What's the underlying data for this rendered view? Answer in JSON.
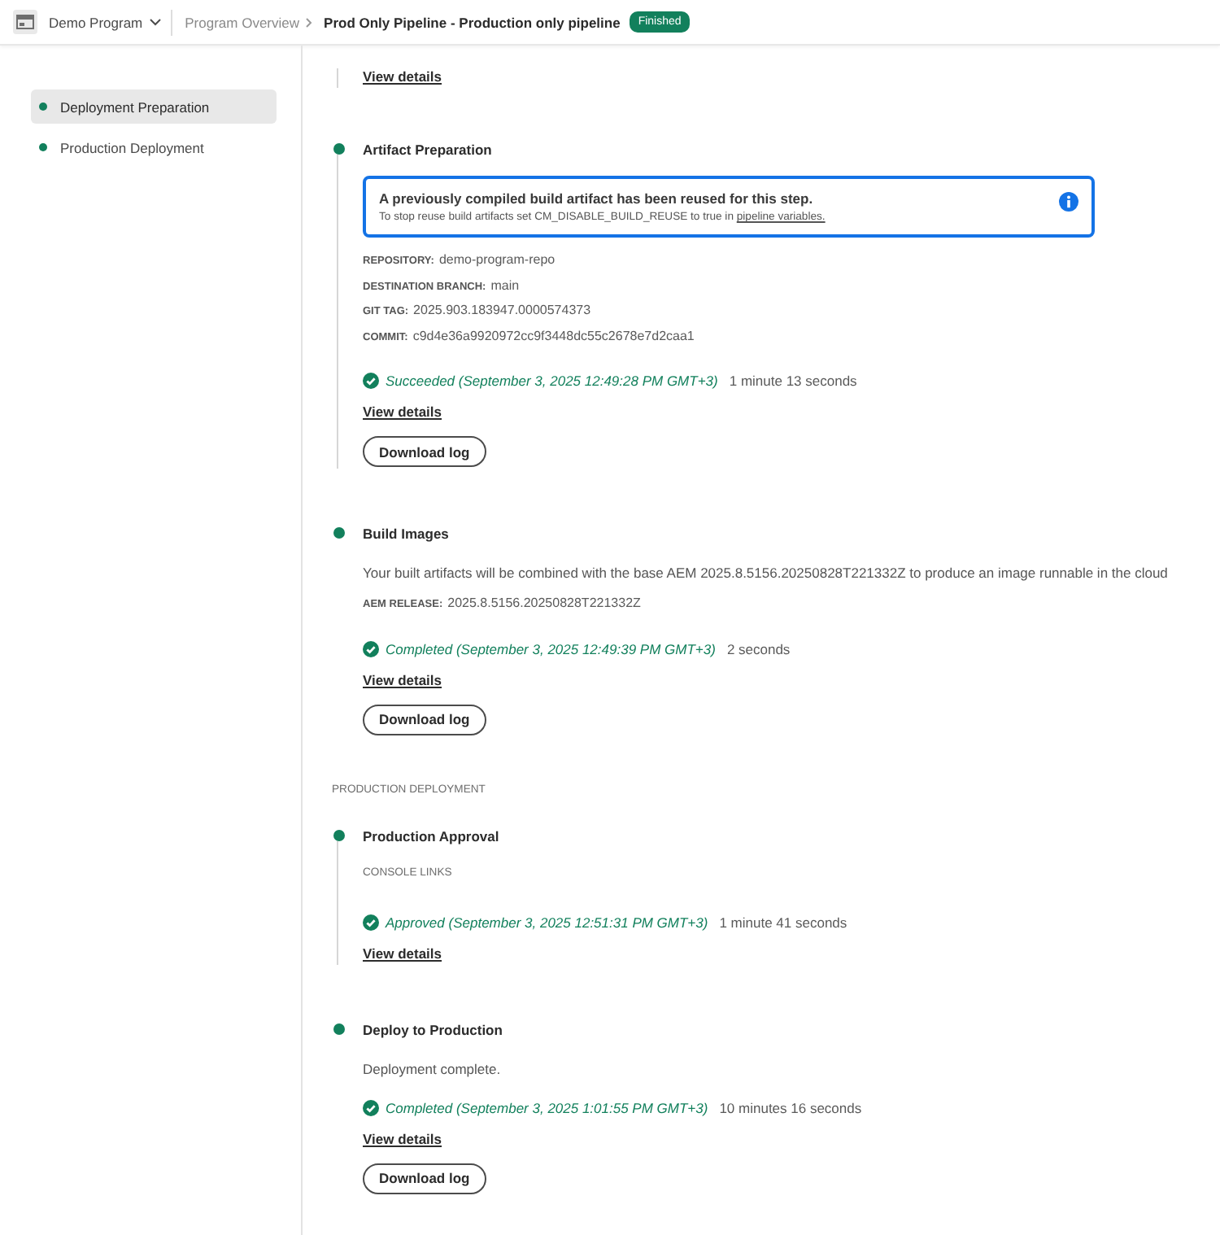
{
  "header": {
    "program": "Demo Program",
    "breadcrumb": "Program Overview",
    "title": "Prod Only Pipeline - Production only pipeline",
    "status_badge": "Finished"
  },
  "sidebar": {
    "items": [
      {
        "label": "Deployment Preparation",
        "selected": true
      },
      {
        "label": "Production Deployment",
        "selected": false
      }
    ]
  },
  "timeline": [
    {
      "kind": "tail",
      "view_details": "View details"
    },
    {
      "kind": "step",
      "title": "Artifact Preparation",
      "notice": {
        "title": "A previously compiled build artifact has been reused for this step.",
        "text": "To stop reuse build artifacts set CM_DISABLE_BUILD_REUSE to true in ",
        "link": "pipeline variables."
      },
      "fields": [
        {
          "label": "REPOSITORY:",
          "value": "demo-program-repo"
        },
        {
          "label": "DESTINATION BRANCH:",
          "value": "main"
        },
        {
          "label": "GIT TAG:",
          "value": "2025.903.183947.0000574373"
        },
        {
          "label": "COMMIT:",
          "value": "c9d4e36a9920972cc9f3448dc55c2678e7d2caa1"
        }
      ],
      "result": {
        "status": "Succeeded (September 3, 2025 12:49:28 PM GMT+3)",
        "duration": "1 minute 13 seconds"
      },
      "view_details": "View details",
      "download": "Download log"
    },
    {
      "kind": "step",
      "title": "Build Images",
      "description": "Your built artifacts will be combined with the base AEM 2025.8.5156.20250828T221332Z to produce an image runnable in the cloud",
      "fields": [
        {
          "label": "AEM RELEASE:",
          "value": "2025.8.5156.20250828T221332Z"
        }
      ],
      "result": {
        "status": "Completed (September 3, 2025 12:49:39 PM GMT+3)",
        "duration": "2 seconds"
      },
      "view_details": "View details",
      "download": "Download log"
    },
    {
      "kind": "section",
      "label": "PRODUCTION DEPLOYMENT"
    },
    {
      "kind": "step",
      "title": "Production Approval",
      "subheading": "CONSOLE LINKS",
      "result": {
        "status": "Approved (September 3, 2025 12:51:31 PM GMT+3)",
        "duration": "1 minute 41 seconds"
      },
      "view_details": "View details"
    },
    {
      "kind": "step",
      "title": "Deploy to Production",
      "description": "Deployment complete.",
      "result": {
        "status": "Completed (September 3, 2025 1:01:55 PM GMT+3)",
        "duration": "10 minutes 16 seconds"
      },
      "view_details": "View details",
      "download": "Download log"
    }
  ]
}
